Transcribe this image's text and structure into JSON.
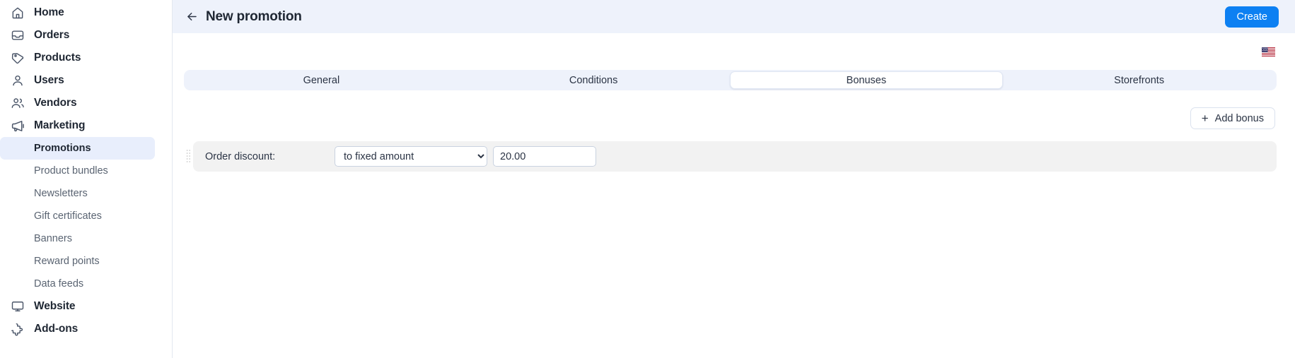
{
  "sidebar": {
    "items": [
      {
        "label": "Home",
        "icon": "home-icon",
        "type": "top"
      },
      {
        "label": "Orders",
        "icon": "orders-inbox-icon",
        "type": "top"
      },
      {
        "label": "Products",
        "icon": "tag-icon",
        "type": "top"
      },
      {
        "label": "Users",
        "icon": "user-icon",
        "type": "top"
      },
      {
        "label": "Vendors",
        "icon": "users-group-icon",
        "type": "top"
      },
      {
        "label": "Marketing",
        "icon": "megaphone-icon",
        "type": "top"
      }
    ],
    "sub_items": [
      {
        "label": "Promotions",
        "active": true
      },
      {
        "label": "Product bundles",
        "active": false
      },
      {
        "label": "Newsletters",
        "active": false
      },
      {
        "label": "Gift certificates",
        "active": false
      },
      {
        "label": "Banners",
        "active": false
      },
      {
        "label": "Reward points",
        "active": false
      },
      {
        "label": "Data feeds",
        "active": false
      }
    ],
    "bottom_items": [
      {
        "label": "Website",
        "icon": "monitor-icon"
      },
      {
        "label": "Add-ons",
        "icon": "puzzle-icon"
      }
    ]
  },
  "topbar": {
    "back_label": "back-arrow",
    "title": "New promotion",
    "create_label": "Create",
    "accent_color": "#0d80f2",
    "background_color": "#eef2fb"
  },
  "content": {
    "language_flag": "us-flag-icon",
    "tabs": [
      {
        "label": "General",
        "active": false
      },
      {
        "label": "Conditions",
        "active": false
      },
      {
        "label": "Bonuses",
        "active": true
      },
      {
        "label": "Storefronts",
        "active": false
      }
    ],
    "add_bonus_label": "Add bonus",
    "add_bonus_plus": "+",
    "bonuses": [
      {
        "label": "Order discount:",
        "select_value": "to fixed amount",
        "select_options": [
          "to fixed amount"
        ],
        "amount_value": "20.00"
      }
    ]
  }
}
